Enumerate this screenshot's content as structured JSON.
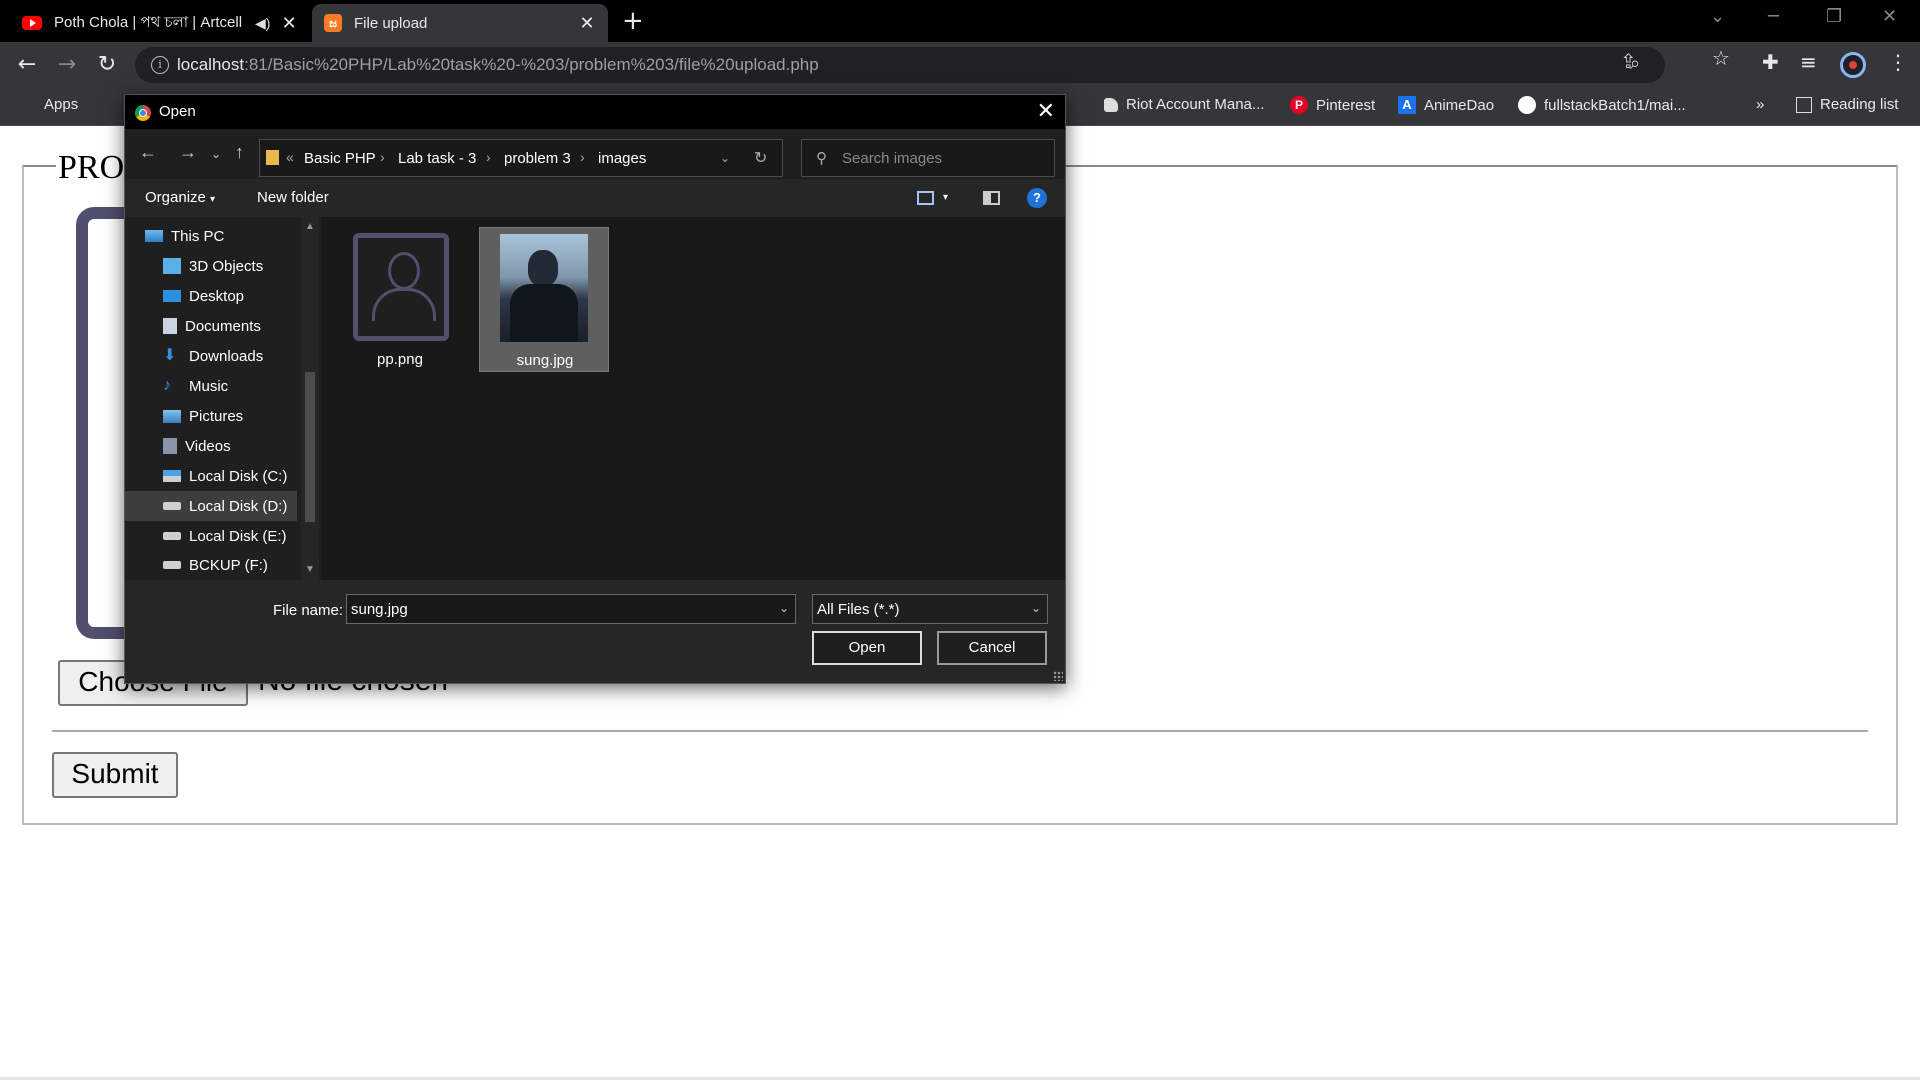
{
  "browser": {
    "tabs": [
      {
        "title": "Poth Chola | পথ চলা | Artcell",
        "active": false
      },
      {
        "title": "File upload",
        "active": true
      }
    ],
    "address": {
      "host": "localhost",
      "path": ":81/Basic%20PHP/Lab%20task%20-%203/problem%203/file%20upload.php"
    },
    "bookmarks": {
      "apps": "Apps",
      "riot": "Riot Account Mana...",
      "pinterest": "Pinterest",
      "animedao": "AnimeDao",
      "github": "fullstackBatch1/mai...",
      "more": "»",
      "reading_list": "Reading list"
    }
  },
  "page": {
    "legend": "PRO",
    "choose_file": "Choose File",
    "no_file": "No file chosen",
    "submit": "Submit"
  },
  "dialog": {
    "title": "Open",
    "breadcrumb": [
      "Basic PHP",
      "Lab task - 3",
      "problem 3",
      "images"
    ],
    "search_placeholder": "Search images",
    "toolbar": {
      "organize": "Organize",
      "new_folder": "New folder"
    },
    "nav_items": [
      {
        "label": "This PC"
      },
      {
        "label": "3D Objects"
      },
      {
        "label": "Desktop"
      },
      {
        "label": "Documents"
      },
      {
        "label": "Downloads"
      },
      {
        "label": "Music"
      },
      {
        "label": "Pictures"
      },
      {
        "label": "Videos"
      },
      {
        "label": "Local Disk (C:)"
      },
      {
        "label": "Local Disk (D:)",
        "selected": true
      },
      {
        "label": "Local Disk (E:)"
      },
      {
        "label": "BCKUP (F:)"
      }
    ],
    "files": [
      {
        "name": "pp.png",
        "selected": false
      },
      {
        "name": "sung.jpg",
        "selected": true
      }
    ],
    "file_name_label": "File name:",
    "file_name_value": "sung.jpg",
    "file_type": "All Files (*.*)",
    "open_label": "Open",
    "cancel_label": "Cancel"
  },
  "colors": {
    "accent": "#8ab4f8",
    "frame": "#50506e",
    "help": "#1e73d8"
  }
}
